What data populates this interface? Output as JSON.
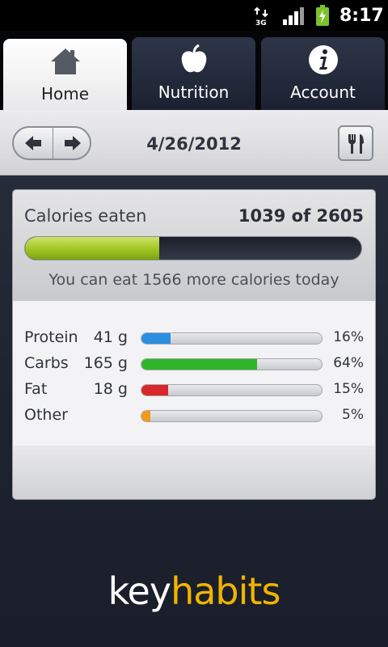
{
  "status_bar": {
    "network_icon": "3g-icon",
    "signal_icon": "signal-icon",
    "battery_icon": "battery-charging-icon",
    "time": "8:17"
  },
  "tabs": [
    {
      "label": "Home",
      "icon": "home-icon",
      "active": true
    },
    {
      "label": "Nutrition",
      "icon": "apple-icon",
      "active": false
    },
    {
      "label": "Account",
      "icon": "info-icon",
      "active": false
    }
  ],
  "toolbar": {
    "date": "4/26/2012",
    "prev_icon": "arrow-left-icon",
    "next_icon": "arrow-right-icon",
    "meal_icon": "fork-knife-icon"
  },
  "calories": {
    "label": "Calories eaten",
    "value": "1039 of 2605",
    "eaten": 1039,
    "goal": 2605,
    "note": "You can eat 1566 more calories today"
  },
  "macros": [
    {
      "name": "Protein",
      "amount": "41 g",
      "percent": "16%",
      "fraction": 0.16,
      "color": "#2a8fe0"
    },
    {
      "name": "Carbs",
      "amount": "165 g",
      "percent": "64%",
      "fraction": 0.64,
      "color": "#2fb52a"
    },
    {
      "name": "Fat",
      "amount": "18 g",
      "percent": "15%",
      "fraction": 0.15,
      "color": "#d8262b"
    },
    {
      "name": "Other",
      "amount": "",
      "percent": "5%",
      "fraction": 0.05,
      "color": "#f29a1a"
    }
  ],
  "brand": {
    "part1": "key",
    "part2": "habits",
    "part1_color": "#ffffff",
    "part2_color": "#f0b400"
  }
}
